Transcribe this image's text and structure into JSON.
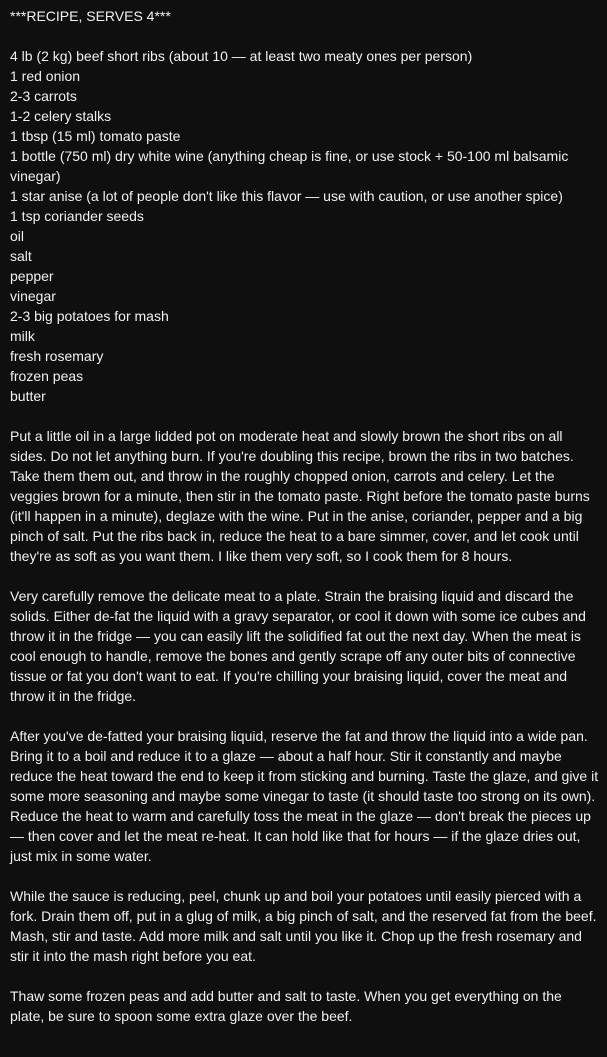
{
  "recipe": {
    "heading": "***RECIPE, SERVES 4***",
    "ingredients": [
      "4 lb (2 kg) beef short ribs (about 10 — at least two meaty ones per person)",
      "1 red onion",
      "2-3 carrots",
      "1-2 celery stalks",
      "1 tbsp (15 ml) tomato paste",
      "1 bottle (750 ml) dry white wine (anything cheap is fine, or use stock + 50-100 ml balsamic vinegar)",
      "1 star anise (a lot of people don't like this flavor — use with caution, or use another spice)",
      "1 tsp coriander seeds",
      "oil",
      "salt",
      "pepper",
      "vinegar",
      "2-3 big potatoes for mash",
      "milk",
      "fresh rosemary",
      "frozen peas",
      "butter"
    ],
    "steps": [
      "Put a little oil in a large lidded pot on moderate heat and slowly brown the short ribs on all sides. Do not let anything burn. If you're doubling this recipe, brown the ribs in two batches. Take them them out, and throw in the roughly chopped onion, carrots and celery. Let the veggies brown for a minute, then stir in the tomato paste. Right before the tomato paste burns (it'll happen in a minute), deglaze with the wine. Put in the anise, coriander, pepper and a big pinch of salt. Put the ribs back in, reduce the heat to a bare simmer, cover, and let cook until they're as soft as you want them. I like them very soft, so I cook them for 8 hours.",
      "Very carefully remove the delicate meat to a plate. Strain the braising liquid and discard the solids. Either de-fat the liquid with a gravy separator, or cool it down with some ice cubes and throw it in the fridge — you can easily lift the solidified fat out the next day. When the meat is cool enough to handle, remove the bones and gently scrape off any outer bits of connective tissue or fat you don't want to eat. If you're chilling your braising liquid, cover the meat and throw it in the fridge.",
      "After you've de-fatted your braising liquid, reserve the fat and throw the liquid into a wide pan. Bring it to a boil and reduce it to a glaze — about a half hour. Stir it constantly and maybe reduce the heat toward the end to keep it from sticking and burning. Taste the glaze, and give it some more seasoning and maybe some vinegar to taste (it should taste too strong on its own). Reduce the heat to warm and carefully toss the meat in the glaze — don't break the pieces up — then cover and let the meat re-heat. It can hold like that for hours — if the glaze dries out, just mix in some water.",
      "While the sauce is reducing, peel, chunk up and boil your potatoes until easily pierced with a fork. Drain them off, put in a glug of milk, a big pinch of salt, and the reserved fat from the beef. Mash, stir and taste. Add more milk and salt until you like it. Chop up the fresh rosemary and stir it into the mash right before you eat.",
      "Thaw some frozen peas and add butter and salt to taste. When you get everything on the plate, be sure to spoon some extra glaze over the beef."
    ]
  },
  "colors": {
    "background": "#0f0f0f",
    "text": "#f1f1f1"
  }
}
